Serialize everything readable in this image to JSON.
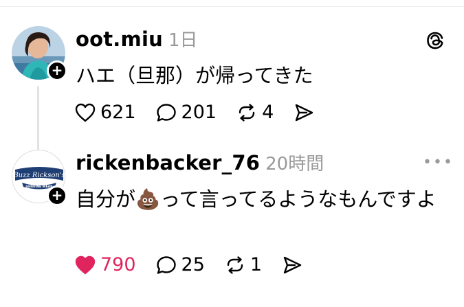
{
  "posts": [
    {
      "username": "oot.miu",
      "timestamp": "1日",
      "text": "ハエ（旦那）が帰ってきた",
      "likes": "621",
      "replies": "201",
      "reposts": "4",
      "liked": false
    },
    {
      "username": "rickenbacker_76",
      "timestamp": "20時間",
      "text_before_emoji": "自分が",
      "emoji": "💩",
      "text_after_emoji": "って言ってるようなもんですよ",
      "avatar_text": "Buzz Rickson's",
      "avatar_subtext": "GENUINE WEAR",
      "likes": "790",
      "replies": "25",
      "reposts": "1",
      "liked": true
    }
  ],
  "icons": {
    "like": "heart-icon",
    "reply": "comment-icon",
    "repost": "repost-icon",
    "share": "send-icon",
    "threads_logo": "threads-logo-icon",
    "more": "more-options-icon",
    "follow": "plus-icon"
  },
  "colors": {
    "liked": "#e0245e",
    "muted": "#9a9a9a"
  }
}
